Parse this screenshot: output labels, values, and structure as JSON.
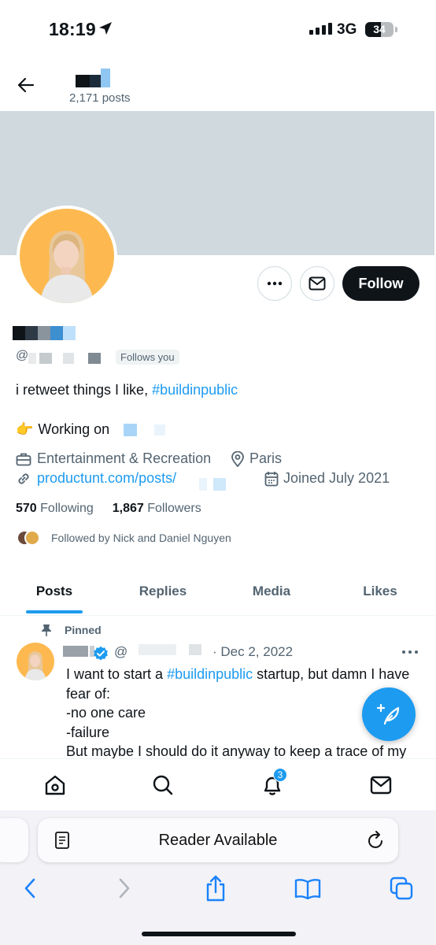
{
  "status_bar": {
    "time": "18:19",
    "network": "3G",
    "battery": "34"
  },
  "header": {
    "posts_count": "2,171 posts"
  },
  "profile": {
    "handle_prefix": "@",
    "follows_you": "Follows you",
    "bio_text": "i retweet things I like, ",
    "bio_hashtag": "#buildinpublic",
    "working_emoji": "👉",
    "working_text": "Working on",
    "category": "Entertainment & Recreation",
    "location": "Paris",
    "website": "productunt.com/posts/",
    "joined": "Joined July 2021",
    "following_count": "570",
    "following_label": "Following",
    "followers_count": "1,867",
    "followers_label": "Followers",
    "followed_by": "Followed by Nick and Daniel Nguyen"
  },
  "buttons": {
    "follow": "Follow"
  },
  "tabs": [
    {
      "label": "Posts",
      "active": true
    },
    {
      "label": "Replies",
      "active": false
    },
    {
      "label": "Media",
      "active": false
    },
    {
      "label": "Likes",
      "active": false
    }
  ],
  "post": {
    "pinned_label": "Pinned",
    "handle_prefix": "@",
    "date": "· Dec 2, 2022",
    "text_1": "I want to start a ",
    "hashtag": "#buildinpublic",
    "text_2": " startup, but damn I have fear of:",
    "line_2": "-no one care",
    "line_3": "-failure",
    "line_4": "But maybe I should do it anyway to keep a trace of my"
  },
  "bottom_nav": {
    "notifications_badge": "3"
  },
  "safari": {
    "url_text": "Reader Available"
  },
  "colors": {
    "accent": "#1d9bf0",
    "text": "#0f1419",
    "secondary": "#536471",
    "banner": "#cfd9de",
    "avatar_bg": "#fdb950"
  },
  "icons": [
    "location-arrow-icon",
    "back-arrow-icon",
    "more-icon",
    "message-icon",
    "briefcase-icon",
    "location-pin-icon",
    "link-icon",
    "calendar-icon",
    "pin-icon",
    "verified-icon",
    "compose-icon",
    "home-icon",
    "search-icon",
    "bell-icon",
    "mail-icon",
    "reader-icon",
    "reload-icon",
    "safari-back-icon",
    "safari-forward-icon",
    "share-icon",
    "bookmarks-icon",
    "tabs-icon"
  ]
}
